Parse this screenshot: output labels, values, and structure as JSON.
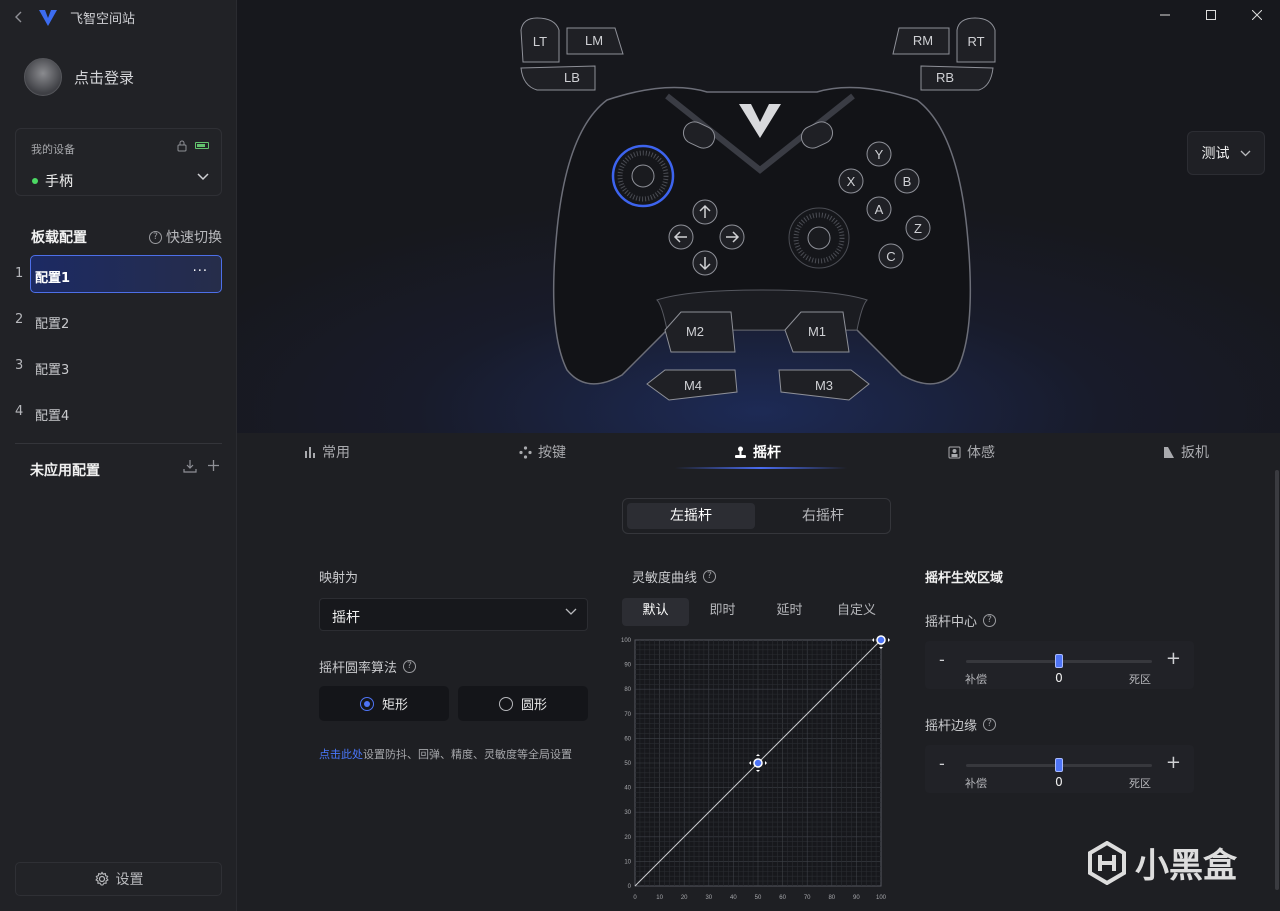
{
  "app": {
    "title": "飞智空间站"
  },
  "profile": {
    "login_text": "点击登录"
  },
  "device": {
    "title": "我的设备",
    "name": "手柄"
  },
  "configs": {
    "header": "板载配置",
    "quick_switch": "快速切换",
    "items": [
      {
        "num": "1",
        "label": "配置1",
        "more": "···"
      },
      {
        "num": "2",
        "label": "配置2"
      },
      {
        "num": "3",
        "label": "配置3"
      },
      {
        "num": "4",
        "label": "配置4"
      }
    ],
    "unapplied": "未应用配置"
  },
  "settings": {
    "label": "设置"
  },
  "controller": {
    "buttons": {
      "lt": "LT",
      "lm": "LM",
      "lb": "LB",
      "rm": "RM",
      "rt": "RT",
      "rb": "RB",
      "y": "Y",
      "x": "X",
      "b": "B",
      "a": "A",
      "z": "Z",
      "c": "C",
      "m1": "M1",
      "m2": "M2",
      "m3": "M3",
      "m4": "M4"
    }
  },
  "test_button": {
    "label": "测试"
  },
  "tabs": [
    {
      "label": "常用"
    },
    {
      "label": "按键"
    },
    {
      "label": "摇杆"
    },
    {
      "label": "体感"
    },
    {
      "label": "扳机"
    }
  ],
  "stick_switch": {
    "left": "左摇杆",
    "right": "右摇杆"
  },
  "mapping": {
    "label": "映射为",
    "value": "摇杆"
  },
  "algorithm": {
    "label": "摇杆圆率算法",
    "options": [
      "矩形",
      "圆形"
    ],
    "selected": "矩形"
  },
  "global_note": {
    "link": "点击此处",
    "text": "设置防抖、回弹、精度、灵敏度等全局设置"
  },
  "curve": {
    "label": "灵敏度曲线",
    "tabs": [
      "默认",
      "即时",
      "延时",
      "自定义"
    ],
    "active": "默认"
  },
  "chart_data": {
    "type": "line",
    "x": [
      0,
      50,
      100
    ],
    "series": [
      {
        "values": [
          0,
          50,
          100
        ]
      }
    ],
    "xlim": [
      0,
      100
    ],
    "ylim": [
      0,
      100
    ],
    "xticks": [
      "0",
      "10",
      "20",
      "30",
      "40",
      "50",
      "60",
      "70",
      "80",
      "90",
      "100"
    ],
    "yticks": [
      "0",
      "10",
      "20",
      "30",
      "40",
      "50",
      "60",
      "70",
      "80",
      "90",
      "100"
    ],
    "grid": true
  },
  "zone": {
    "title": "摇杆生效区域",
    "center": {
      "label": "摇杆中心",
      "minus": "-",
      "plus": "+",
      "left": "补偿",
      "value": "0",
      "right": "死区",
      "level": 0.5
    },
    "edge": {
      "label": "摇杆边缘",
      "minus": "-",
      "plus": "+",
      "left": "补偿",
      "value": "0",
      "right": "死区",
      "level": 0.5
    }
  },
  "watermark": {
    "text": "小黑盒"
  },
  "colors": {
    "accent": "#4e74f5",
    "online": "#4cd964",
    "link": "#4a78ff"
  }
}
